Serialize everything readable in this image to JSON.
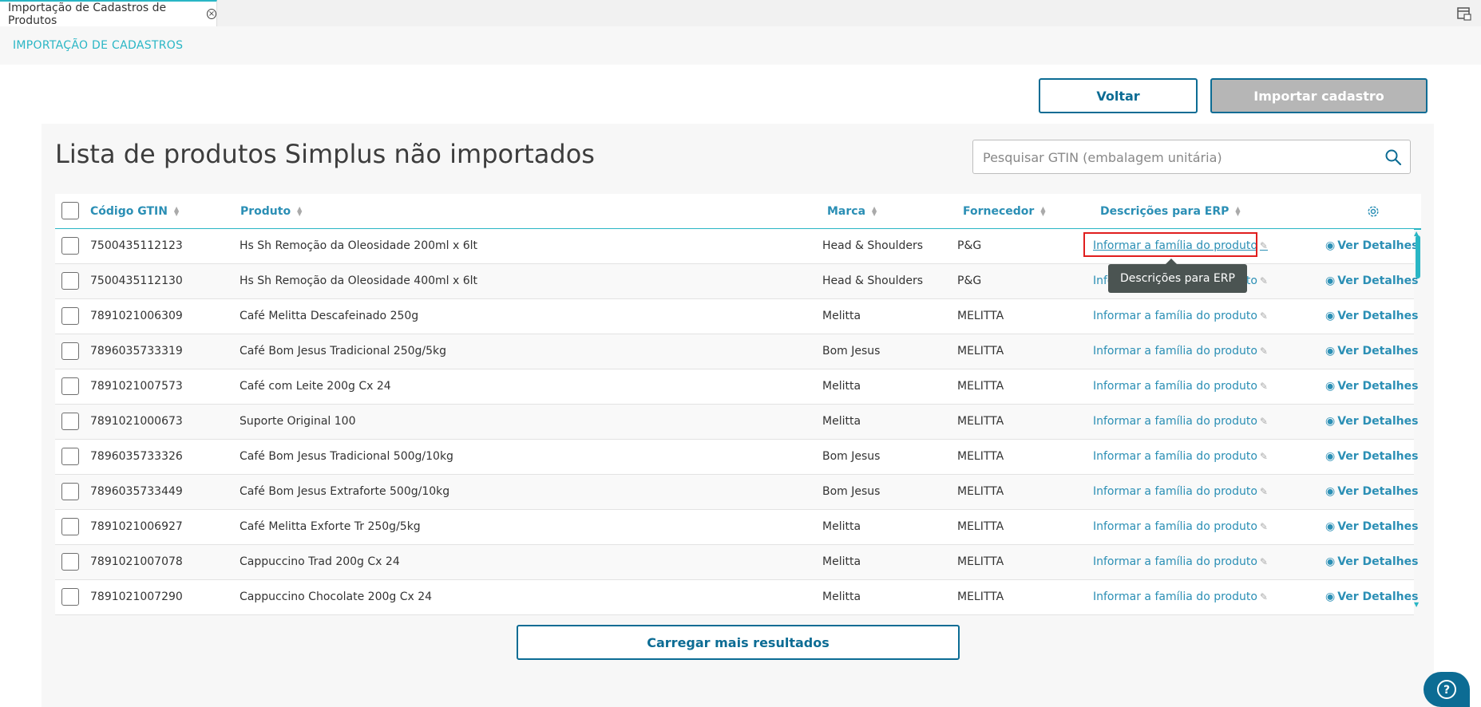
{
  "tab": {
    "label": "Importação de Cadastros de Produtos"
  },
  "header": {
    "title": "IMPORTAÇÃO DE CADASTROS"
  },
  "actions": {
    "back_label": "Voltar",
    "import_label": "Importar cadastro"
  },
  "list": {
    "title": "Lista de produtos Simplus não importados",
    "search_placeholder": "Pesquisar GTIN (embalagem unitária)"
  },
  "table": {
    "columns": [
      "Código GTIN",
      "Produto",
      "Marca",
      "Fornecedor",
      "Descrições para ERP"
    ],
    "erp_link_label": "Informar a família do produto",
    "details_label": "Ver Detalhes",
    "rows": [
      {
        "gtin": "7500435112123",
        "produto": "Hs Sh Remoção da Oleosidade 200ml x 6lt",
        "marca": "Head & Shoulders",
        "fornecedor": "P&G"
      },
      {
        "gtin": "7500435112130",
        "produto": "Hs Sh Remoção da Oleosidade 400ml x 6lt",
        "marca": "Head & Shoulders",
        "fornecedor": "P&G"
      },
      {
        "gtin": "7891021006309",
        "produto": "Café Melitta Descafeinado 250g",
        "marca": "Melitta",
        "fornecedor": "MELITTA"
      },
      {
        "gtin": "7896035733319",
        "produto": "Café Bom Jesus Tradicional 250g/5kg",
        "marca": "Bom Jesus",
        "fornecedor": "MELITTA"
      },
      {
        "gtin": "7891021007573",
        "produto": "Café com Leite 200g Cx 24",
        "marca": "Melitta",
        "fornecedor": "MELITTA"
      },
      {
        "gtin": "7891021000673",
        "produto": "Suporte Original 100",
        "marca": "Melitta",
        "fornecedor": "MELITTA"
      },
      {
        "gtin": "7896035733326",
        "produto": "Café Bom Jesus Tradicional 500g/10kg",
        "marca": "Bom Jesus",
        "fornecedor": "MELITTA"
      },
      {
        "gtin": "7896035733449",
        "produto": "Café Bom Jesus Extraforte 500g/10kg",
        "marca": "Bom Jesus",
        "fornecedor": "MELITTA"
      },
      {
        "gtin": "7891021006927",
        "produto": "Café Melitta Exforte Tr 250g/5kg",
        "marca": "Melitta",
        "fornecedor": "MELITTA"
      },
      {
        "gtin": "7891021007078",
        "produto": "Cappuccino Trad 200g Cx 24",
        "marca": "Melitta",
        "fornecedor": "MELITTA"
      },
      {
        "gtin": "7891021007290",
        "produto": "Cappuccino Chocolate 200g Cx 24",
        "marca": "Melitta",
        "fornecedor": "MELITTA"
      }
    ]
  },
  "tooltip": {
    "text": "Descrições para ERP"
  },
  "load_more": {
    "label": "Carregar mais resultados"
  },
  "colors": {
    "accent": "#29b6c5",
    "primary": "#0c6c94",
    "highlight": "#e01e1e"
  }
}
